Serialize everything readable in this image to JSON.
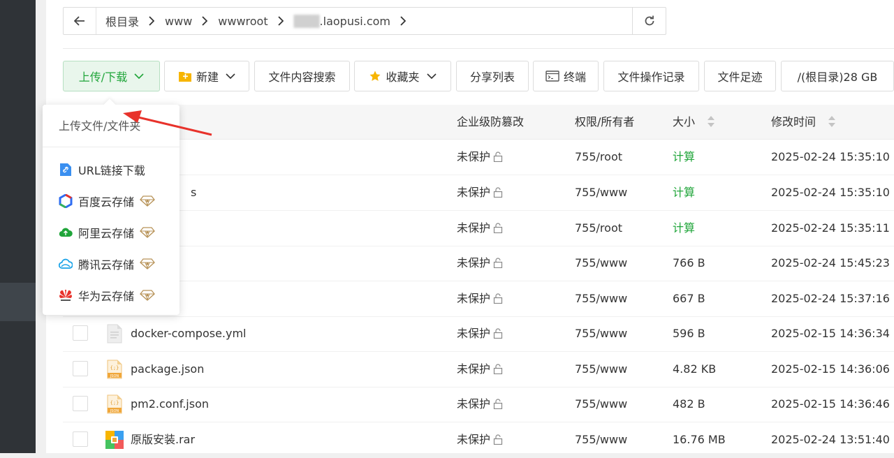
{
  "breadcrumb": {
    "items": [
      {
        "label": "根目录"
      },
      {
        "label": "www"
      },
      {
        "label": "wwwroot"
      },
      {
        "label": "███.laopusi.com"
      }
    ]
  },
  "toolbar": {
    "upload_download": "上传/下载",
    "new": "新建",
    "content_search": "文件内容搜索",
    "favorites": "收藏夹",
    "share_list": "分享列表",
    "terminal": "终端",
    "operation_log": "文件操作记录",
    "file_trace": "文件足迹",
    "disk": "/(根目录)28 GB"
  },
  "table": {
    "headers": {
      "protection": "企业级防篡改",
      "perm_owner": "权限/所有者",
      "size": "大小",
      "mtime": "修改时间"
    },
    "rows": [
      {
        "name": "",
        "icon": "folder-icon",
        "protection": "未保护",
        "perm": "755/root",
        "size": "计算",
        "mtime": "2025-02-24 15:35:10"
      },
      {
        "name": "s",
        "icon": "folder-icon",
        "protection": "未保护",
        "perm": "755/www",
        "size": "计算",
        "mtime": "2025-02-24 15:35:10"
      },
      {
        "name": "",
        "icon": "folder-icon",
        "protection": "未保护",
        "perm": "755/root",
        "size": "计算",
        "mtime": "2025-02-24 15:35:11"
      },
      {
        "name": "",
        "icon": "file-icon",
        "protection": "未保护",
        "perm": "755/www",
        "size": "766 B",
        "mtime": "2025-02-24 15:45:23"
      },
      {
        "name": "",
        "icon": "file-icon",
        "protection": "未保护",
        "perm": "755/www",
        "size": "667 B",
        "mtime": "2025-02-24 15:37:16"
      },
      {
        "name": "docker-compose.yml",
        "icon": "text-file-icon",
        "protection": "未保护",
        "perm": "755/www",
        "size": "596 B",
        "mtime": "2025-02-15 14:36:34"
      },
      {
        "name": "package.json",
        "icon": "json-file-icon",
        "protection": "未保护",
        "perm": "755/www",
        "size": "4.82 KB",
        "mtime": "2025-02-15 14:36:06"
      },
      {
        "name": "pm2.conf.json",
        "icon": "json-file-icon",
        "protection": "未保护",
        "perm": "755/www",
        "size": "482 B",
        "mtime": "2025-02-15 14:36:46"
      },
      {
        "name": "原版安装.rar",
        "icon": "rar-file-icon",
        "protection": "未保护",
        "perm": "755/www",
        "size": "16.76 MB",
        "mtime": "2025-02-24 13:51:40"
      }
    ]
  },
  "dropdown": {
    "header": "上传文件/文件夹",
    "items": [
      {
        "label": "URL链接下载",
        "icon": "link-icon",
        "vip": false
      },
      {
        "label": "百度云存储",
        "icon": "baidu-cloud-icon",
        "vip": true
      },
      {
        "label": "阿里云存储",
        "icon": "aliyun-icon",
        "vip": true
      },
      {
        "label": "腾讯云存储",
        "icon": "tencent-cloud-icon",
        "vip": true
      },
      {
        "label": "华为云存储",
        "icon": "huawei-cloud-icon",
        "vip": true
      }
    ]
  },
  "colors": {
    "accent_green": "#20a53a",
    "annotation_red": "#e8322b",
    "sidebar": "#2f3337"
  }
}
